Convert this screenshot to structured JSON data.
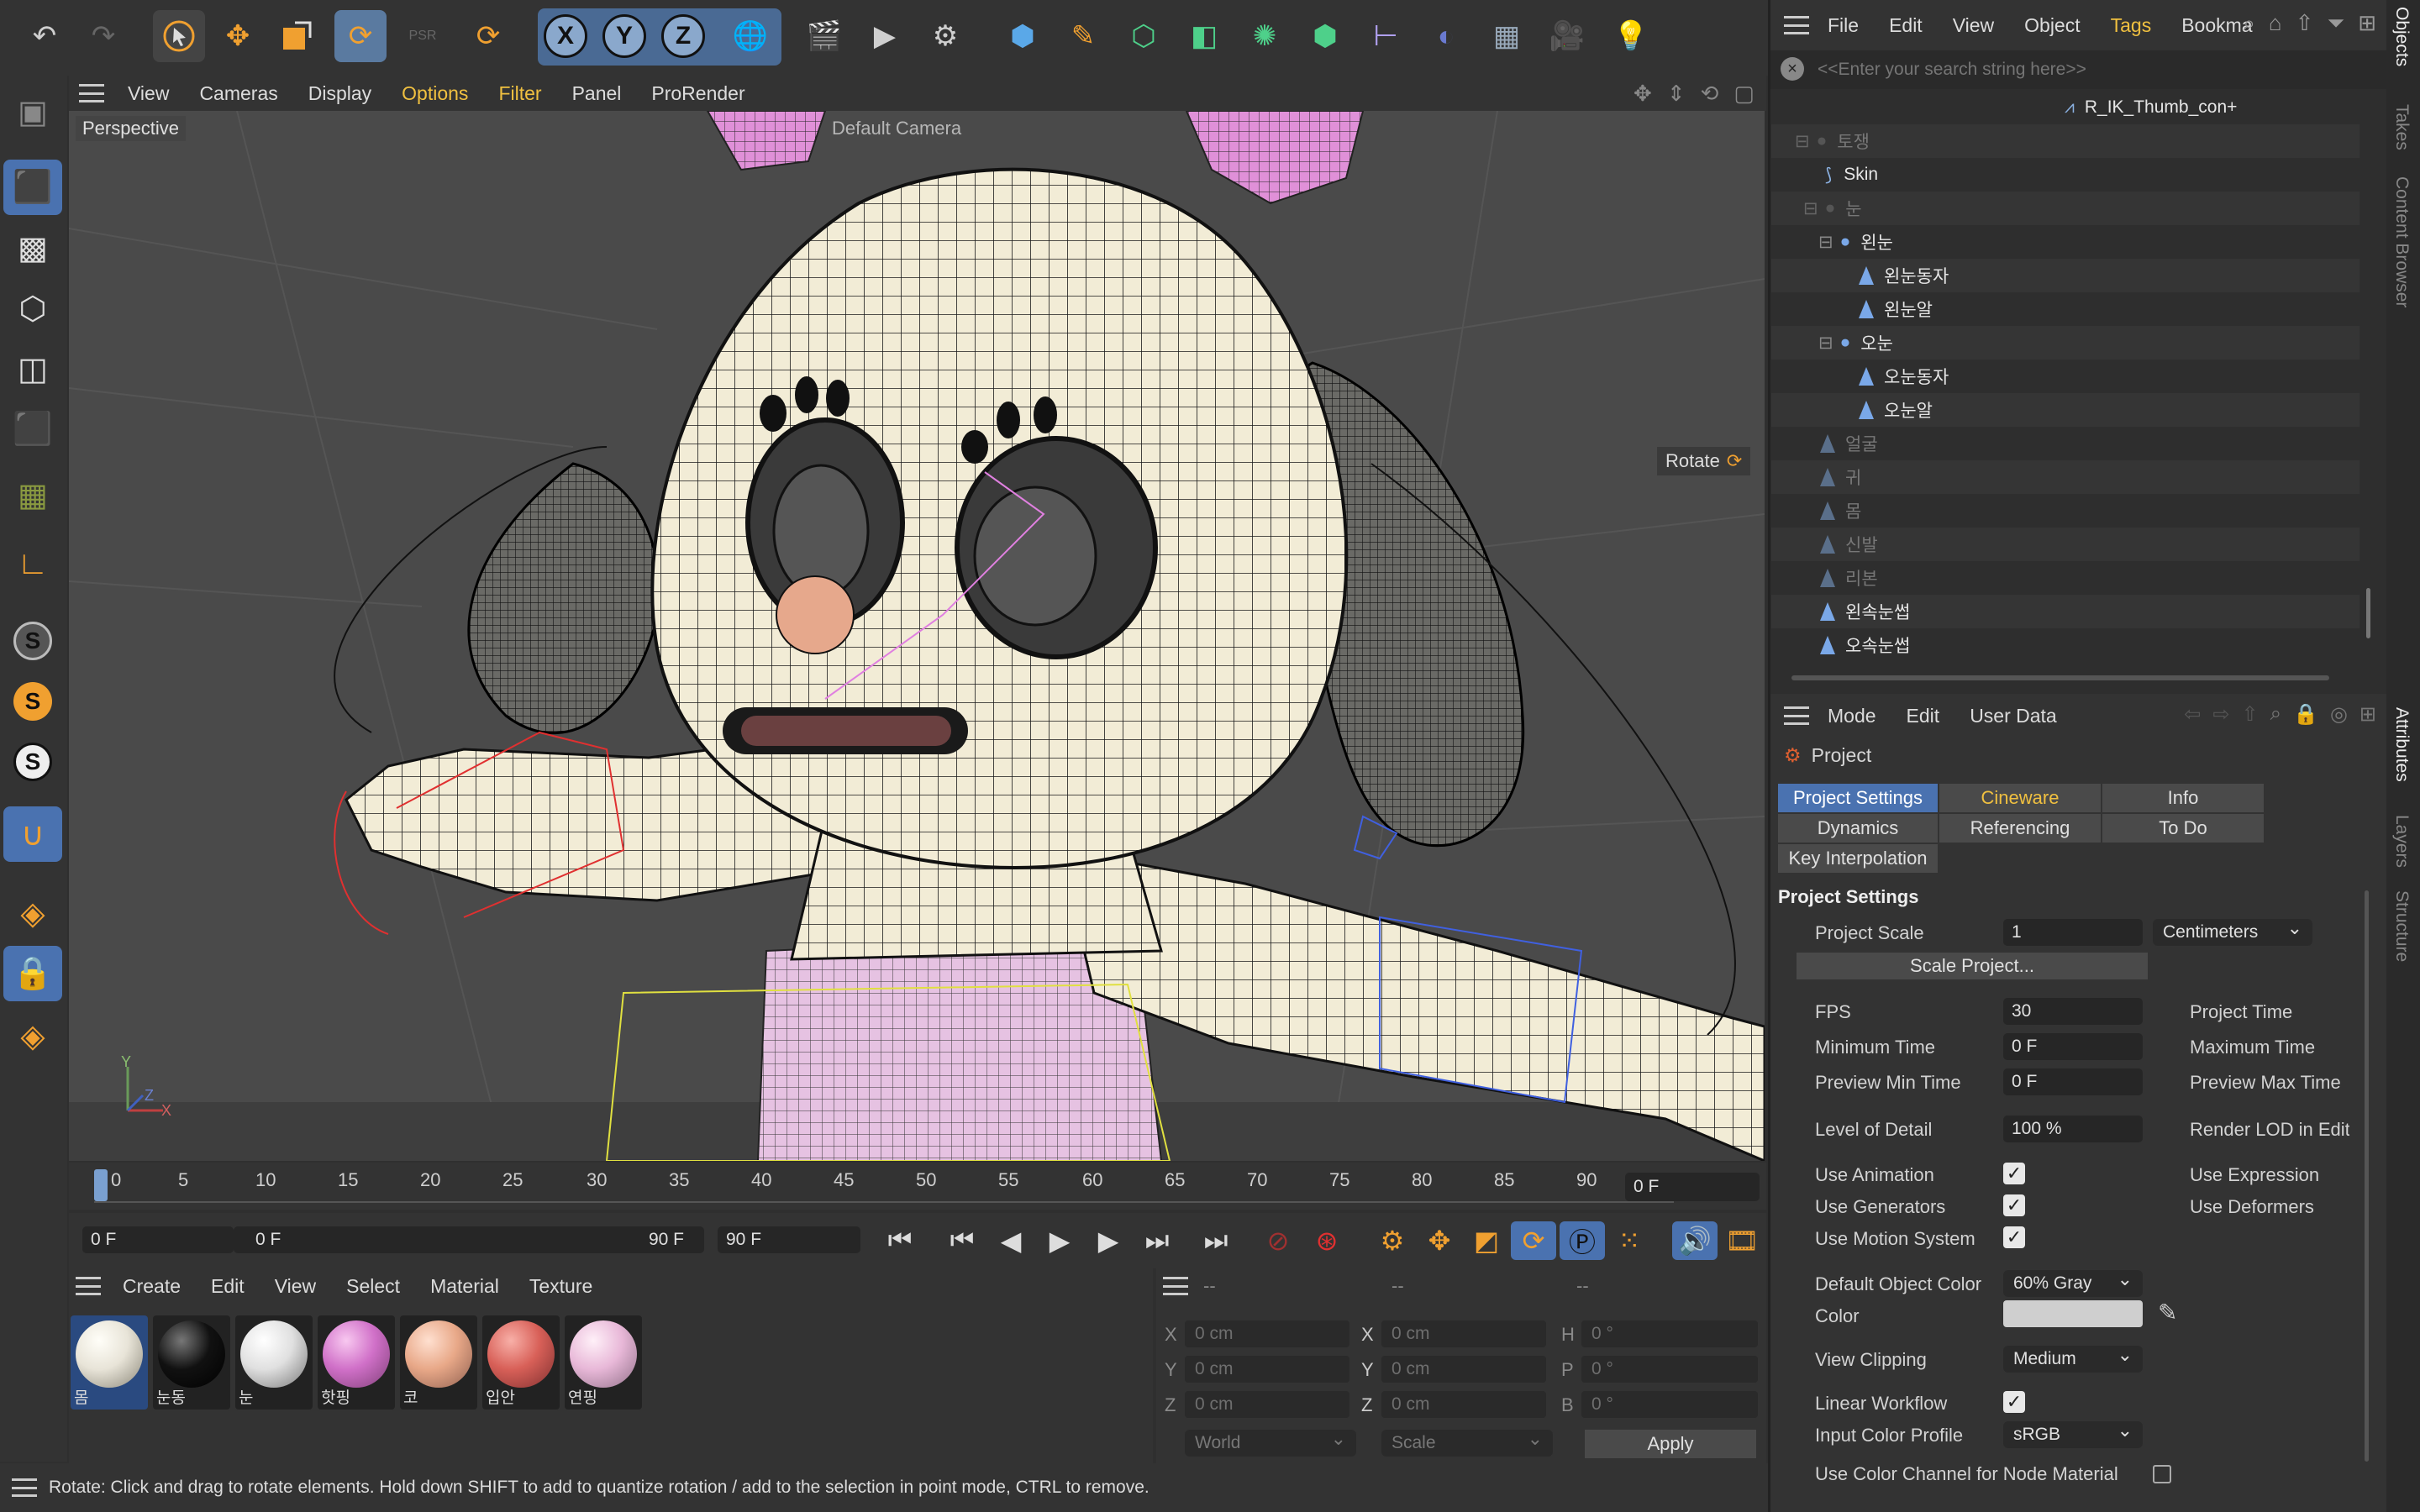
{
  "toolbar": {
    "icons": [
      "undo-icon",
      "redo-icon",
      "select-icon",
      "move-icon",
      "scale-icon",
      "rotate-icon",
      "psr-icon",
      "recent-icon",
      "x-axis-icon",
      "y-axis-icon",
      "z-axis-icon",
      "world-icon",
      "render-view-icon",
      "render-icon",
      "render-settings-icon",
      "cube-icon",
      "pen-icon",
      "subdivision-icon",
      "extrude-icon",
      "cloner-icon",
      "array-icon",
      "deformer-icon",
      "field-icon",
      "floor-icon",
      "camera-icon",
      "light-icon"
    ],
    "axis_labels": [
      "X",
      "Y",
      "Z"
    ]
  },
  "viewport": {
    "menu": [
      "View",
      "Cameras",
      "Display",
      "Options",
      "Filter",
      "Panel",
      "ProRender"
    ],
    "highlighted_menu": [
      "Options",
      "Filter"
    ],
    "label": "Perspective",
    "camera_label": "Default Camera",
    "mode_label": "Rotate",
    "axes": [
      "Y",
      "Z",
      "X"
    ]
  },
  "left_tools": [
    "view-icon",
    "model-icon",
    "texture-icon",
    "points-icon",
    "edges-icon",
    "polygons-icon",
    "uv-icon",
    "axis-icon",
    "snap-s-icon",
    "snap-s2-icon",
    "snap-s3-icon",
    "magnet-icon",
    "workplane-icon",
    "lock-grid-icon",
    "animate-grid-icon"
  ],
  "timeline": {
    "ticks": [
      "0",
      "5",
      "10",
      "15",
      "20",
      "25",
      "30",
      "35",
      "40",
      "45",
      "50",
      "55",
      "60",
      "65",
      "70",
      "75",
      "80",
      "85",
      "90"
    ],
    "current_frame": "0 F",
    "start": "0 F",
    "range_start": "0 F",
    "range_end": "90 F",
    "end": "90 F"
  },
  "materials": {
    "menu": [
      "Create",
      "Edit",
      "View",
      "Select",
      "Material",
      "Texture"
    ],
    "items": [
      {
        "name": "몸",
        "color": "#e8e4d8"
      },
      {
        "name": "눈동",
        "color": "#111111"
      },
      {
        "name": "눈",
        "color": "#e0e0e0"
      },
      {
        "name": "핫핑",
        "color": "#d070c8"
      },
      {
        "name": "코",
        "color": "#e8a888"
      },
      {
        "name": "입안",
        "color": "#d86058"
      },
      {
        "name": "연핑",
        "color": "#e8b8d8"
      }
    ]
  },
  "coords": {
    "header": [
      "--",
      "--",
      "--"
    ],
    "rows": [
      {
        "a": "X",
        "av": "0 cm",
        "b": "X",
        "bv": "0 cm",
        "c": "H",
        "cv": "0 °"
      },
      {
        "a": "Y",
        "av": "0 cm",
        "b": "Y",
        "bv": "0 cm",
        "c": "P",
        "cv": "0 °"
      },
      {
        "a": "Z",
        "av": "0 cm",
        "b": "Z",
        "bv": "0 cm",
        "c": "B",
        "cv": "0 °"
      }
    ],
    "world": "World",
    "scale": "Scale",
    "apply": "Apply"
  },
  "objects": {
    "menu": [
      "File",
      "Edit",
      "View",
      "Object",
      "Tags",
      "Bookma"
    ],
    "search_placeholder": "<<Enter your search string here>>",
    "top_item": "R_IK_Thumb_con+",
    "rows": [
      {
        "label": "토쟁",
        "dim": true
      },
      {
        "label": "Skin",
        "dim": false
      },
      {
        "label": "눈",
        "dim": true
      },
      {
        "label": "왼눈",
        "dim": false
      },
      {
        "label": "왼눈동자",
        "dim": false
      },
      {
        "label": "왼눈알",
        "dim": false
      },
      {
        "label": "오눈",
        "dim": false
      },
      {
        "label": "오눈동자",
        "dim": false
      },
      {
        "label": "오눈알",
        "dim": false
      },
      {
        "label": "얼굴",
        "dim": true
      },
      {
        "label": "귀",
        "dim": true
      },
      {
        "label": "몸",
        "dim": true
      },
      {
        "label": "신발",
        "dim": true
      },
      {
        "label": "리본",
        "dim": true
      },
      {
        "label": "왼속눈썹",
        "dim": false
      },
      {
        "label": "오속눈썹",
        "dim": false
      }
    ]
  },
  "side_tabs": {
    "top": [
      "Objects",
      "Takes",
      "Content Browser"
    ],
    "bottom": [
      "Attributes",
      "Layers",
      "Structure"
    ]
  },
  "attributes": {
    "menu": [
      "Mode",
      "Edit",
      "User Data"
    ],
    "title": "Project",
    "tabs": [
      [
        "Project Settings",
        "Cineware",
        "Info"
      ],
      [
        "Dynamics",
        "Referencing",
        "To Do"
      ],
      [
        "Key Interpolation"
      ]
    ],
    "section": "Project Settings",
    "project_scale_label": "Project Scale",
    "project_scale_value": "1",
    "project_scale_unit": "Centimeters",
    "scale_button": "Scale Project...",
    "fps_label": "FPS",
    "fps_value": "30",
    "min_time_label": "Minimum Time",
    "min_time_value": "0 F",
    "preview_min_label": "Preview Min Time",
    "preview_min_value": "0 F",
    "lod_label": "Level of Detail",
    "lod_value": "100 %",
    "project_time_label": "Project Time",
    "max_time_label": "Maximum Time",
    "preview_max_label": "Preview Max Time",
    "render_lod_label": "Render LOD in Edit",
    "use_animation": "Use Animation",
    "use_generators": "Use Generators",
    "use_motion": "Use Motion System",
    "use_expression": "Use Expression",
    "use_deformers": "Use Deformers",
    "default_color_label": "Default Object Color",
    "default_color_value": "60% Gray",
    "color_label": "Color",
    "view_clipping_label": "View Clipping",
    "view_clipping_value": "Medium",
    "linear_workflow": "Linear Workflow",
    "input_profile_label": "Input Color Profile",
    "input_profile_value": "sRGB",
    "color_channel": "Use Color Channel for Node Material"
  },
  "status": "Rotate: Click and drag to rotate elements. Hold down SHIFT to add to quantize rotation / add to the selection in point mode, CTRL to remove.",
  "colors": {
    "accent": "#4a72b0",
    "highlight": "#f0c040",
    "orange": "#f0a030"
  }
}
